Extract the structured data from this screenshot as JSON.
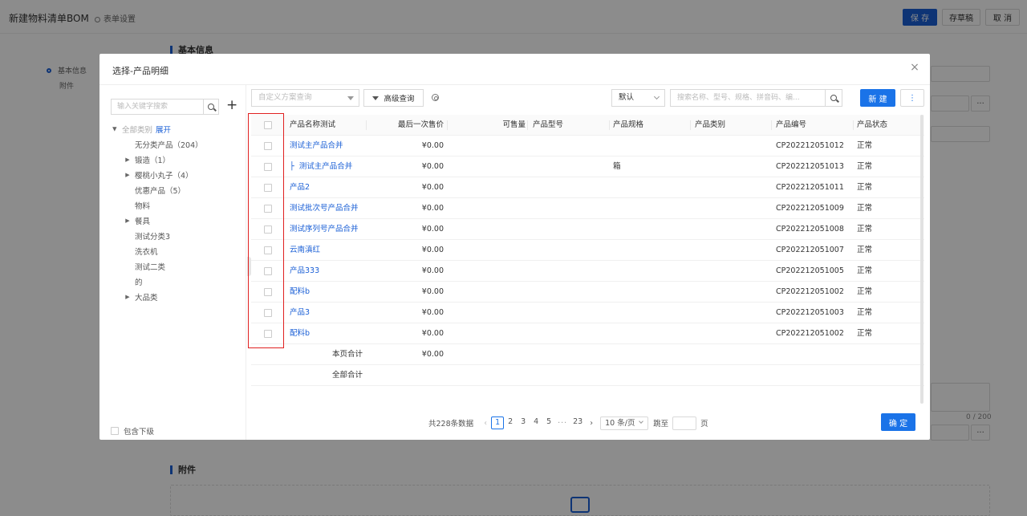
{
  "page": {
    "title": "新建物料清单BOM",
    "form_settings": "表单设置",
    "buttons": {
      "save": "保 存",
      "draft": "存草稿",
      "cancel": "取 消"
    },
    "side_nav": [
      {
        "label": "基本信息"
      },
      {
        "label": "附件"
      }
    ],
    "sections": {
      "basic": "基本信息",
      "attachments": "附件"
    },
    "char_counter": "0 / 200",
    "more": "···"
  },
  "modal": {
    "title": "选择-产品明细",
    "close": "×",
    "left": {
      "search_placeholder": "输入关键字搜索",
      "add": "+",
      "tree": [
        {
          "label": "全部类别",
          "extra": "展开",
          "caret": "▶"
        },
        {
          "label": "无分类产品（204）",
          "caret": ""
        },
        {
          "label": "锻造（1）",
          "caret": "▶"
        },
        {
          "label": "樱桃小丸子（4）",
          "caret": "▶"
        },
        {
          "label": "优惠产品（5）",
          "caret": ""
        },
        {
          "label": "物料",
          "caret": ""
        },
        {
          "label": "餐具",
          "caret": "▶"
        },
        {
          "label": "测试分类3",
          "caret": ""
        },
        {
          "label": "洗衣机",
          "caret": ""
        },
        {
          "label": "测试二类",
          "caret": ""
        },
        {
          "label": "的",
          "caret": ""
        },
        {
          "label": "大品类",
          "caret": "▶"
        }
      ],
      "include_sub": "包含下级"
    },
    "toolbar": {
      "scheme_placeholder": "自定义方案查询",
      "advanced_query": "高级查询",
      "sort_default": "默认",
      "search_placeholder": "搜索名称、型号、规格、拼音码、编...",
      "new": "新 建",
      "more": "⋮"
    },
    "table": {
      "columns": [
        "产品名称测试",
        "最后一次售价",
        "可售量",
        "产品型号",
        "产品规格",
        "产品类别",
        "产品编号",
        "产品状态"
      ],
      "rows": [
        {
          "name": "测试主产品合并",
          "price": "¥0.00",
          "spec": "",
          "code": "CP202212051012",
          "status": "正常",
          "child": false
        },
        {
          "name": "测试主产品合并",
          "price": "¥0.00",
          "spec": "箱",
          "code": "CP202212051013",
          "status": "正常",
          "child": true
        },
        {
          "name": "产品2",
          "price": "¥0.00",
          "spec": "",
          "code": "CP202212051011",
          "status": "正常",
          "child": false
        },
        {
          "name": "测试批次号产品合并",
          "price": "¥0.00",
          "spec": "",
          "code": "CP202212051009",
          "status": "正常",
          "child": false
        },
        {
          "name": "测试序列号产品合并",
          "price": "¥0.00",
          "spec": "",
          "code": "CP202212051008",
          "status": "正常",
          "child": false
        },
        {
          "name": "云南滇红",
          "price": "¥0.00",
          "spec": "",
          "code": "CP202212051007",
          "status": "正常",
          "child": false
        },
        {
          "name": "产品333",
          "price": "¥0.00",
          "spec": "",
          "code": "CP202212051005",
          "status": "正常",
          "child": false
        },
        {
          "name": "配料b",
          "price": "¥0.00",
          "spec": "",
          "code": "CP202212051002",
          "status": "正常",
          "child": false
        },
        {
          "name": "产品3",
          "price": "¥0.00",
          "spec": "",
          "code": "CP202212051003",
          "status": "正常",
          "child": false
        },
        {
          "name": "配料b",
          "price": "¥0.00",
          "spec": "",
          "code": "CP202212051002",
          "status": "正常",
          "child": false
        }
      ],
      "page_total_label": "本页合计",
      "page_total_value": "¥0.00",
      "all_total_label": "全部合计"
    },
    "pagination": {
      "total": "共228条数据",
      "pages": [
        "1",
        "2",
        "3",
        "4",
        "5"
      ],
      "current": "1",
      "ellipsis": "···",
      "last": "23",
      "page_size": "10 条/页",
      "goto": "跳至",
      "page_unit": "页"
    },
    "confirm": "确 定"
  }
}
